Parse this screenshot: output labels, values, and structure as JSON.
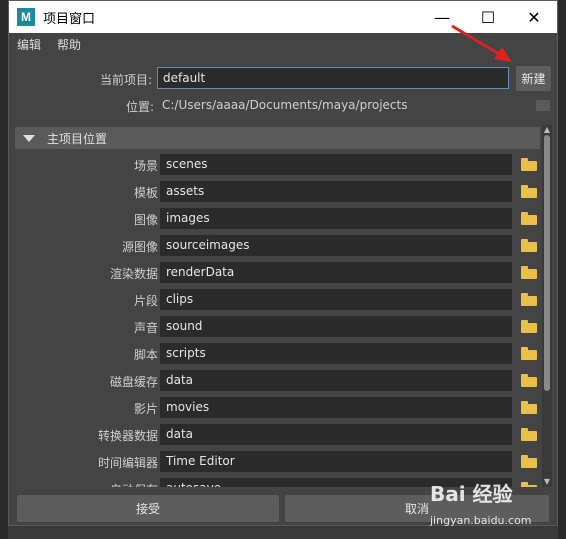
{
  "window": {
    "app_icon_letter": "M",
    "title": "项目窗口",
    "minimize_glyph": "—",
    "maximize_glyph": "☐",
    "close_glyph": "✕"
  },
  "menu": [
    "编辑",
    "帮助"
  ],
  "current_project": {
    "label": "当前项目:",
    "value": "default",
    "new_button": "新建"
  },
  "location": {
    "label": "位置:",
    "value": "C:/Users/aaaa/Documents/maya/projects"
  },
  "section": {
    "title": "主项目位置",
    "rows": [
      {
        "label": "场景",
        "value": "scenes"
      },
      {
        "label": "模板",
        "value": "assets"
      },
      {
        "label": "图像",
        "value": "images"
      },
      {
        "label": "源图像",
        "value": "sourceimages"
      },
      {
        "label": "渲染数据",
        "value": "renderData"
      },
      {
        "label": "片段",
        "value": "clips"
      },
      {
        "label": "声音",
        "value": "sound"
      },
      {
        "label": "脚本",
        "value": "scripts"
      },
      {
        "label": "磁盘缓存",
        "value": "data"
      },
      {
        "label": "影片",
        "value": "movies"
      },
      {
        "label": "转换器数据",
        "value": "data"
      },
      {
        "label": "时间编辑器",
        "value": "Time Editor"
      },
      {
        "label": "自动保存",
        "value": "autosave"
      }
    ]
  },
  "buttons": {
    "accept": "接受",
    "cancel": "取消"
  },
  "watermark": {
    "logo": "Bai 经验",
    "url": "jingyan.baidu.com"
  },
  "colors": {
    "arrow": "#e02020",
    "folder": "#e8c04a",
    "focus_border": "#5d8fbf"
  },
  "icons": {
    "folder": "folder-icon",
    "arrow": "red-arrow-annotation"
  }
}
